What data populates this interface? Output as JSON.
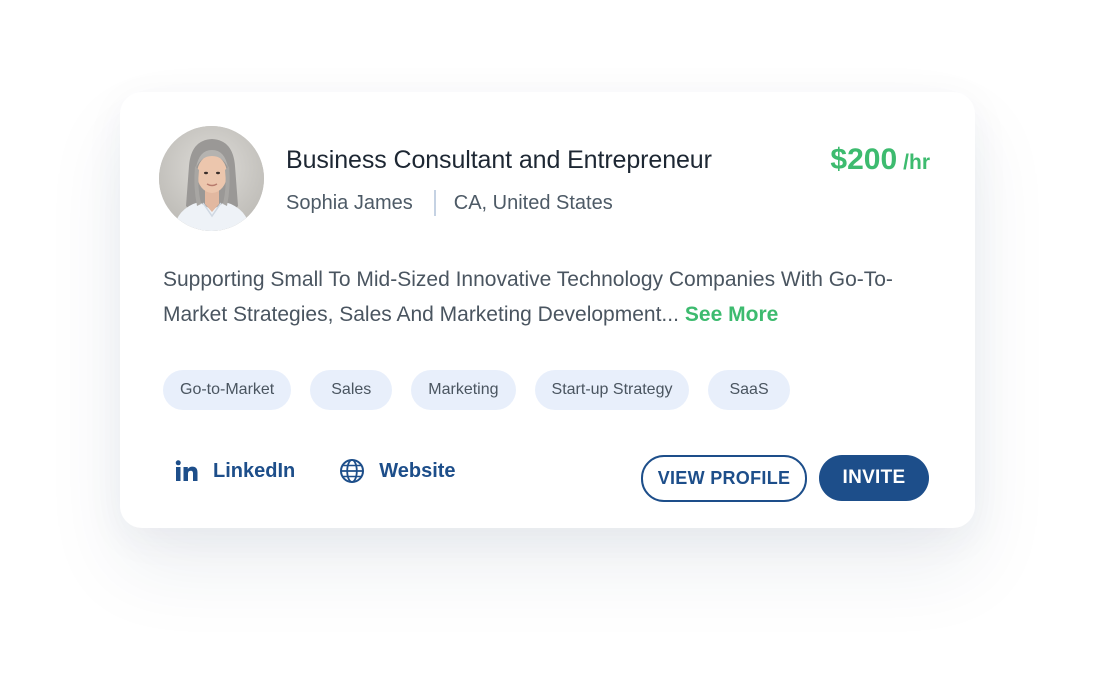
{
  "profile": {
    "title": "Business Consultant and Entrepreneur",
    "name": "Sophia James",
    "location": "CA, United States",
    "rate_amount": "$200",
    "rate_unit": "/hr",
    "description": "Supporting Small To Mid-Sized Innovative Technology Companies With Go-To-Market Strategies, Sales And Marketing Development...",
    "see_more_label": "See More",
    "avatar_icon": "avatar"
  },
  "tags": [
    "Go-to-Market",
    "Sales",
    "Marketing",
    "Start-up Strategy",
    "SaaS"
  ],
  "links": {
    "linkedin_label": "LinkedIn",
    "linkedin_icon": "linkedin-icon",
    "website_label": "Website",
    "website_icon": "globe-icon"
  },
  "actions": {
    "view_profile_label": "VIEW PROFILE",
    "invite_label": "INVITE"
  },
  "colors": {
    "accent_green": "#3dbb6f",
    "brand_blue": "#1d4e8a",
    "tag_bg": "#e8effb",
    "text_dark": "#1d2733",
    "text_muted": "#4a5560"
  }
}
